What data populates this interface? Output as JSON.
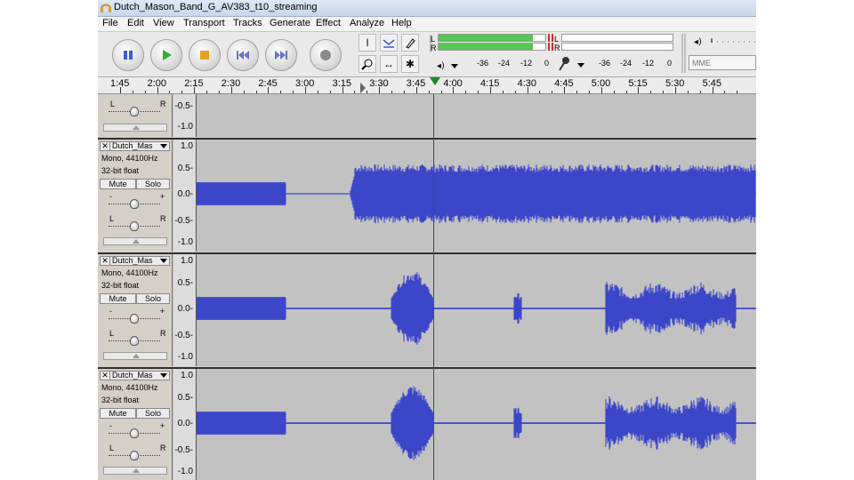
{
  "window": {
    "title": "Dutch_Mason_Band_G_AV383_t10_streaming"
  },
  "menu": [
    "File",
    "Edit",
    "View",
    "Transport",
    "Tracks",
    "Generate",
    "Effect",
    "Analyze",
    "Help"
  ],
  "transport": {
    "buttons": [
      {
        "name": "pause-button",
        "icon": "pause-icon",
        "color": "#3a5bd7"
      },
      {
        "name": "play-button",
        "icon": "play-icon",
        "color": "#2fb12f"
      },
      {
        "name": "stop-button",
        "icon": "stop-icon",
        "color": "#e0a420"
      },
      {
        "name": "skip-start-button",
        "icon": "skip-to-start-icon",
        "color": "#6a73c8"
      },
      {
        "name": "skip-end-button",
        "icon": "skip-to-end-icon",
        "color": "#6a73c8"
      },
      {
        "name": "record-button",
        "icon": "record-icon",
        "color": "#8a8a8a"
      }
    ]
  },
  "meters": {
    "playback": {
      "L": "L",
      "R": "R",
      "L_level": 0.88,
      "R_level": 0.88
    },
    "record": {
      "L": "L",
      "R": "R"
    },
    "scale_play": [
      "-36",
      "-24",
      "-12",
      "0"
    ],
    "scale_rec": [
      "-36",
      "-24",
      "-12",
      "0"
    ]
  },
  "mixer": {
    "device_placeholder": "MME"
  },
  "ruler": {
    "labels": [
      "1:45",
      "2:00",
      "2:15",
      "2:30",
      "2:45",
      "3:00",
      "3:15",
      "3:30",
      "3:45",
      "4:00",
      "4:15",
      "4:30",
      "4:45",
      "5:00",
      "5:15",
      "5:30",
      "5:45"
    ]
  },
  "partial_track": {
    "scale": [
      "-0.5-",
      "-1.0"
    ],
    "pan": {
      "left": "L",
      "right": "R"
    }
  },
  "tracks": [
    {
      "name": "Dutch_Mas",
      "rate": "Mono, 44100Hz",
      "format": "32-bit float",
      "mute": "Mute",
      "solo": "Solo",
      "gain": {
        "minus": "-",
        "plus": "+",
        "level": 0.5
      },
      "pan": {
        "left": "L",
        "right": "R",
        "level": 0.5
      },
      "scale": [
        "1.0",
        "0.5-",
        "0.0-",
        "-0.5-",
        "-1.0"
      ],
      "wave_color": "#3c46c8"
    },
    {
      "name": "Dutch_Mas",
      "rate": "Mono, 44100Hz",
      "format": "32-bit float",
      "mute": "Mute",
      "solo": "Solo",
      "gain": {
        "minus": "-",
        "plus": "+",
        "level": 0.5
      },
      "pan": {
        "left": "L",
        "right": "R",
        "level": 0.5
      },
      "scale": [
        "1.0",
        "0.5-",
        "0.0-",
        "-0.5-",
        "-1.0"
      ],
      "wave_color": "#3c46c8"
    },
    {
      "name": "Dutch_Mas",
      "rate": "Mono, 44100Hz",
      "format": "32-bit float",
      "mute": "Mute",
      "solo": "Solo",
      "gain": {
        "minus": "-",
        "plus": "+",
        "level": 0.5
      },
      "pan": {
        "left": "L",
        "right": "R",
        "level": 0.5
      },
      "scale": [
        "1.0",
        "0.5-",
        "0.0-",
        "-0.5-",
        "-1.0"
      ],
      "wave_color": "#3c46c8"
    }
  ],
  "colors": {
    "wave": "#3c46c8",
    "meter_green": "#54c653",
    "cursor": "#1d6a1f"
  }
}
